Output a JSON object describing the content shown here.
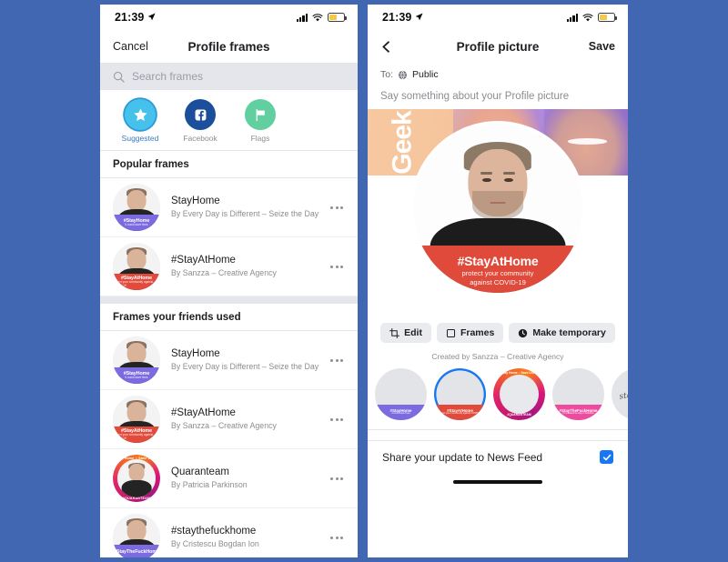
{
  "theme": {
    "background": "#4267B2",
    "accent": "#1877F2",
    "band_red": "#E04A3A",
    "band_purple": "#7B6AE0",
    "chip_bg": "#E9EBEE"
  },
  "left_phone": {
    "status_bar": {
      "time": "21:39",
      "location_icon": "location-arrow-icon",
      "signal_icon": "cellular-bars-icon",
      "wifi_icon": "wifi-icon",
      "battery_icon": "battery-low-power-icon"
    },
    "nav": {
      "cancel": "Cancel",
      "title": "Profile frames"
    },
    "search": {
      "placeholder": "Search frames",
      "icon": "search-icon"
    },
    "categories": [
      {
        "label": "Suggested",
        "icon": "star-icon",
        "selected": true
      },
      {
        "label": "Facebook",
        "icon": "facebook-f-icon",
        "selected": false
      },
      {
        "label": "Flags",
        "icon": "flag-icon",
        "selected": false
      }
    ],
    "sections": [
      {
        "header": "Popular frames",
        "items": [
          {
            "title": "StayHome",
            "author": "By Every Day is Different – Seize the Day",
            "band_text": "#StayHome",
            "band_sub": "it could save lives",
            "style": "purple"
          },
          {
            "title": "#StayAtHome",
            "author": "By Sanzza – Creative Agency",
            "band_text": "#StayAtHome",
            "band_sub": "protect your community against COVID-19",
            "style": "red"
          }
        ]
      },
      {
        "header": "Frames your friends used",
        "items": [
          {
            "title": "StayHome",
            "author": "By Every Day is Different – Seize the Day",
            "band_text": "#StayHome",
            "band_sub": "it could save lives",
            "style": "purple"
          },
          {
            "title": "#StayAtHome",
            "author": "By Sanzza – Creative Agency",
            "band_text": "#StayAtHome",
            "band_sub": "protect your community against COVID-19",
            "style": "red"
          },
          {
            "title": "Quaranteam",
            "author": "By Patricia Parkinson",
            "ring_top": "Stay Home ⌂ Save Lives",
            "ring_bottom": "#QUARANTEAM",
            "style": "quaranteam"
          },
          {
            "title": "#staythefuckhome",
            "author": "By Cristescu Bogdan Ion",
            "band_text": "#StayTheFuckHome",
            "band_sub": "",
            "style": "purple"
          }
        ]
      }
    ],
    "row_menu_icon": "more-options-icon"
  },
  "right_phone": {
    "status_bar": {
      "time": "21:39",
      "location_icon": "location-arrow-icon",
      "signal_icon": "cellular-bars-icon",
      "wifi_icon": "wifi-icon",
      "battery_icon": "battery-low-power-icon"
    },
    "nav": {
      "back_icon": "chevron-left-icon",
      "title": "Profile picture",
      "save": "Save"
    },
    "audience": {
      "prefix": "To:",
      "icon": "globe-public-icon",
      "value": "Public"
    },
    "compose_placeholder": "Say something about your Profile picture",
    "cover": {
      "word": "Geek"
    },
    "profile_frame": {
      "headline": "#StayAtHome",
      "sub_line_1": "protect your community",
      "sub_line_2": "against COVID-19"
    },
    "actions": [
      {
        "label": "Edit",
        "icon": "crop-icon"
      },
      {
        "label": "Frames",
        "icon": "frame-icon"
      },
      {
        "label": "Make temporary",
        "icon": "clock-icon"
      }
    ],
    "credit": "Created by Sanzza – Creative Agency",
    "carousel": [
      {
        "name": "StayHome",
        "band_text": "#StayHome",
        "band_sub": "it could save lives",
        "style": "purple",
        "selected": false
      },
      {
        "name": "#StayAtHome",
        "band_text": "#StayAtHome",
        "band_sub": "protect your community against COVID-19",
        "style": "red",
        "selected": true
      },
      {
        "name": "Quaranteam",
        "ring_top": "Stay Home ⌂ Save Lives",
        "ring_bottom": "#QUARANTEAM",
        "style": "quaranteam",
        "selected": false
      },
      {
        "name": "#StayTheFuckHome",
        "band_text": "#StayTheFuckHome",
        "band_sub": "I'm blessed to stay in isolation",
        "style": "pink",
        "selected": false
      },
      {
        "name": "Script frame",
        "script_text": "stay safe",
        "style": "script",
        "selected": false
      }
    ],
    "share": {
      "label": "Share your update to News Feed",
      "checked": true,
      "check_icon": "checkmark-icon"
    },
    "home_indicator": "home-indicator"
  }
}
